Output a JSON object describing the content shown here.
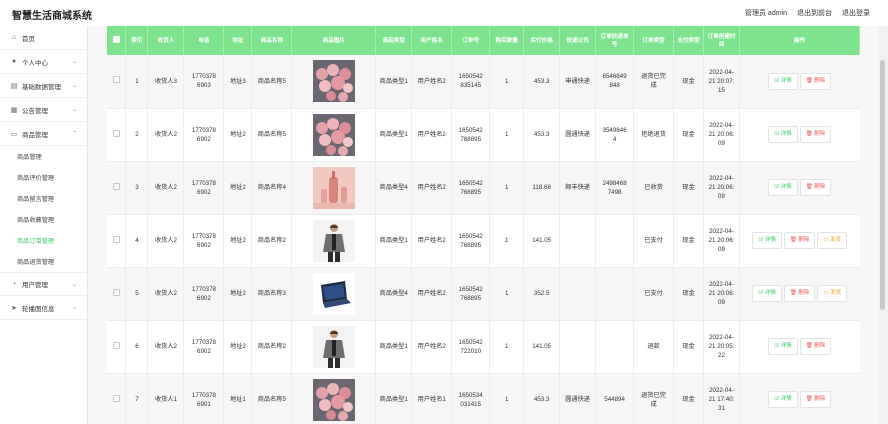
{
  "app": {
    "title": "智慧生活商城系统"
  },
  "toplinks": {
    "admin": "管理员 admin",
    "front": "退出到前台",
    "logout": "退出登录"
  },
  "sidebar": {
    "items": [
      {
        "label": "首页",
        "icon": "home-icon"
      },
      {
        "label": "个人中心",
        "icon": "user-icon"
      },
      {
        "label": "基础数据管理",
        "icon": "database-icon"
      },
      {
        "label": "公告管理",
        "icon": "notice-icon"
      },
      {
        "label": "商品管理",
        "icon": "goods-icon"
      }
    ],
    "sub": [
      "商品管理",
      "商品评价管理",
      "商品留言管理",
      "商品收藏管理",
      "商品订单管理",
      "商品退货管理"
    ],
    "bottom": [
      {
        "label": "用户管理",
        "icon": "users-icon"
      },
      {
        "label": "轮播图信息",
        "icon": "send-icon"
      }
    ]
  },
  "table": {
    "headers": [
      "索引",
      "收货人",
      "电话",
      "地址",
      "商品名称",
      "商品图片",
      "商品类型",
      "用户姓名",
      "订单号",
      "购买数量",
      "实付价格",
      "快递公司",
      "订单快递单号",
      "订单类型",
      "支付类型",
      "订单创建时间",
      "操作"
    ],
    "rows": [
      {
        "idx": "1",
        "receiver": "收货人3",
        "phone": [
          "1770378",
          "6903"
        ],
        "addr": "地址3",
        "goods": "商品名称5",
        "img": "flowers",
        "type": "商品类型1",
        "user": "用户姓名2",
        "order": [
          "1650542",
          "835145"
        ],
        "qty": "1",
        "price": "453.3",
        "express": "申通快递",
        "track": [
          "6546849",
          "848"
        ],
        "otype": [
          "退货已完",
          "成"
        ],
        "pay": "现金",
        "time": [
          "2022-04-",
          "21 20:07:",
          "15"
        ],
        "actions": [
          "详情",
          "删除"
        ]
      },
      {
        "idx": "2",
        "receiver": "收货人2",
        "phone": [
          "1770378",
          "6902"
        ],
        "addr": "地址2",
        "goods": "商品名称5",
        "img": "flowers",
        "type": "商品类型1",
        "user": "用户姓名2",
        "order": [
          "1650542",
          "768895"
        ],
        "qty": "1",
        "price": "453.3",
        "express": "圆通快递",
        "track": [
          "3549846",
          "4"
        ],
        "otype": [
          "拒绝退货"
        ],
        "pay": "现金",
        "time": [
          "2022-04-",
          "21 20:06:",
          "09"
        ],
        "actions": [
          "详情",
          "删除"
        ]
      },
      {
        "idx": "3",
        "receiver": "收货人2",
        "phone": [
          "1770378",
          "6902"
        ],
        "addr": "地址2",
        "goods": "商品名称4",
        "img": "vase",
        "type": "商品类型4",
        "user": "用户姓名2",
        "order": [
          "1650542",
          "768895"
        ],
        "qty": "1",
        "price": "118.68",
        "express": "顺丰快递",
        "track": [
          "2498468",
          "7498"
        ],
        "otype": [
          "已收货"
        ],
        "pay": "现金",
        "time": [
          "2022-04-",
          "21 20:06:",
          "09"
        ],
        "actions": [
          "详情",
          "删除"
        ]
      },
      {
        "idx": "4",
        "receiver": "收货人2",
        "phone": [
          "1770378",
          "6902"
        ],
        "addr": "地址2",
        "goods": "商品名称2",
        "img": "man",
        "type": "商品类型1",
        "user": "用户姓名2",
        "order": [
          "1650542",
          "768895"
        ],
        "qty": "1",
        "price": "141.05",
        "express": "",
        "track": [
          ""
        ],
        "otype": [
          "已支付"
        ],
        "pay": "现金",
        "time": [
          "2022-04-",
          "21 20:06:",
          "09"
        ],
        "actions": [
          "详情",
          "删除",
          "发货"
        ]
      },
      {
        "idx": "5",
        "receiver": "收货人2",
        "phone": [
          "1770378",
          "6902"
        ],
        "addr": "地址2",
        "goods": "商品名称3",
        "img": "laptop",
        "type": "商品类型4",
        "user": "用户姓名2",
        "order": [
          "1650542",
          "768895"
        ],
        "qty": "1",
        "price": "352.5",
        "express": "",
        "track": [
          ""
        ],
        "otype": [
          "已支付"
        ],
        "pay": "现金",
        "time": [
          "2022-04-",
          "21 20:06:",
          "09"
        ],
        "actions": [
          "详情",
          "删除",
          "发货"
        ]
      },
      {
        "idx": "6",
        "receiver": "收货人2",
        "phone": [
          "1770378",
          "6902"
        ],
        "addr": "地址2",
        "goods": "商品名称2",
        "img": "man",
        "type": "商品类型1",
        "user": "用户姓名2",
        "order": [
          "1650542",
          "722010"
        ],
        "qty": "1",
        "price": "141.05",
        "express": "",
        "track": [
          ""
        ],
        "otype": [
          "退款"
        ],
        "pay": "现金",
        "time": [
          "2022-04-",
          "21 20:05:",
          "22"
        ],
        "actions": [
          "详情",
          "删除"
        ]
      },
      {
        "idx": "7",
        "receiver": "收货人1",
        "phone": [
          "1770378",
          "6901"
        ],
        "addr": "地址1",
        "goods": "商品名称5",
        "img": "flowers",
        "type": "商品类型1",
        "user": "用户姓名1",
        "order": [
          "1650534",
          "031415"
        ],
        "qty": "1",
        "price": "453.3",
        "express": "圆通快递",
        "track": [
          "544894"
        ],
        "otype": [
          "退货已完",
          "成"
        ],
        "pay": "现金",
        "time": [
          "2022-04-",
          "21 17:40:",
          "31"
        ],
        "actions": [
          "详情",
          "删除"
        ]
      }
    ]
  },
  "colors": {
    "header_green": "#7fe28c",
    "active_menu": "#39c96a",
    "detail": "#39c96a",
    "delete": "#ee5555",
    "ship": "#e9a623"
  }
}
